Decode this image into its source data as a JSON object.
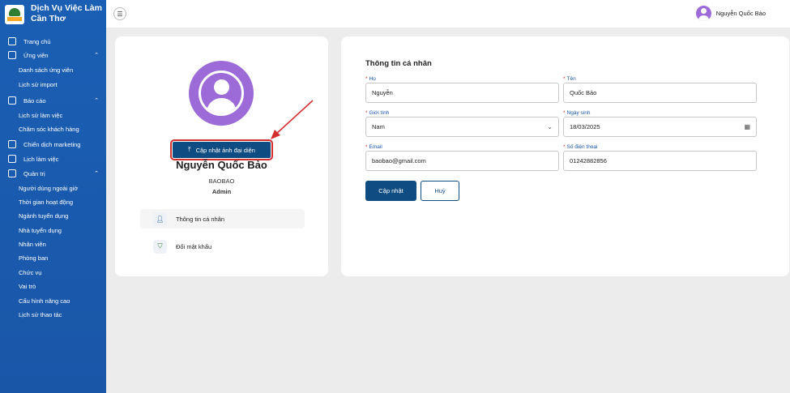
{
  "brand": {
    "line1": "Dịch Vụ Việc Làm",
    "line2": "Cần Thơ"
  },
  "sidebar": {
    "items": [
      {
        "label": "Trang chủ",
        "type": "top"
      },
      {
        "label": "Ứng viên",
        "type": "top",
        "chevron": "^"
      },
      {
        "label": "Danh sách ứng viên",
        "type": "sub"
      },
      {
        "label": "Lịch sử import",
        "type": "sub"
      },
      {
        "label": "Báo cáo",
        "type": "top",
        "chevron": "^"
      },
      {
        "label": "Lịch sử làm việc",
        "type": "sub"
      },
      {
        "label": "Chăm sóc khách hàng",
        "type": "sub"
      },
      {
        "label": "Chiến dịch marketing",
        "type": "top"
      },
      {
        "label": "Lịch làm việc",
        "type": "top"
      },
      {
        "label": "Quản trị",
        "type": "top",
        "chevron": "^"
      },
      {
        "label": "Người dùng ngoài giờ",
        "type": "sub"
      },
      {
        "label": "Thời gian hoạt động",
        "type": "sub"
      },
      {
        "label": "Ngành tuyển dụng",
        "type": "sub"
      },
      {
        "label": "Nhà tuyển dụng",
        "type": "sub"
      },
      {
        "label": "Nhân viên",
        "type": "sub"
      },
      {
        "label": "Phòng ban",
        "type": "sub"
      },
      {
        "label": "Chức vụ",
        "type": "sub"
      },
      {
        "label": "Vai trò",
        "type": "sub"
      },
      {
        "label": "Cấu hình nâng cao",
        "type": "sub"
      },
      {
        "label": "Lịch sử thao tác",
        "type": "sub"
      }
    ]
  },
  "topbar": {
    "user_name": "Nguyễn Quốc Bảo"
  },
  "profile": {
    "upload_label": "Cập nhật ảnh đại diện",
    "name": "Nguyễn Quốc Bảo",
    "username": "BAOBAO",
    "role": "Admin",
    "links": [
      {
        "label": "Thông tin cá nhân",
        "icon": "user-icon"
      },
      {
        "label": "Đổi mật khẩu",
        "icon": "shield-icon"
      }
    ]
  },
  "form": {
    "title": "Thông tin cá nhân",
    "ho_label": "Họ",
    "ho_value": "Nguyễn",
    "ten_label": "Tên",
    "ten_value": "Quốc Bảo",
    "gender_label": "Giới tính",
    "gender_value": "Nam",
    "dob_label": "Ngày sinh",
    "dob_value": "18/03/2025",
    "email_label": "Email",
    "email_value": "baobao@gmail.com",
    "phone_label": "Số điện thoại",
    "phone_value": "01242882856",
    "submit_label": "Cập nhật",
    "cancel_label": "Huỷ"
  },
  "colors": {
    "sidebar": "#1a5fb4",
    "primary": "#0f4c81",
    "avatar": "#9c6bd8",
    "highlight": "#d32f2f"
  }
}
